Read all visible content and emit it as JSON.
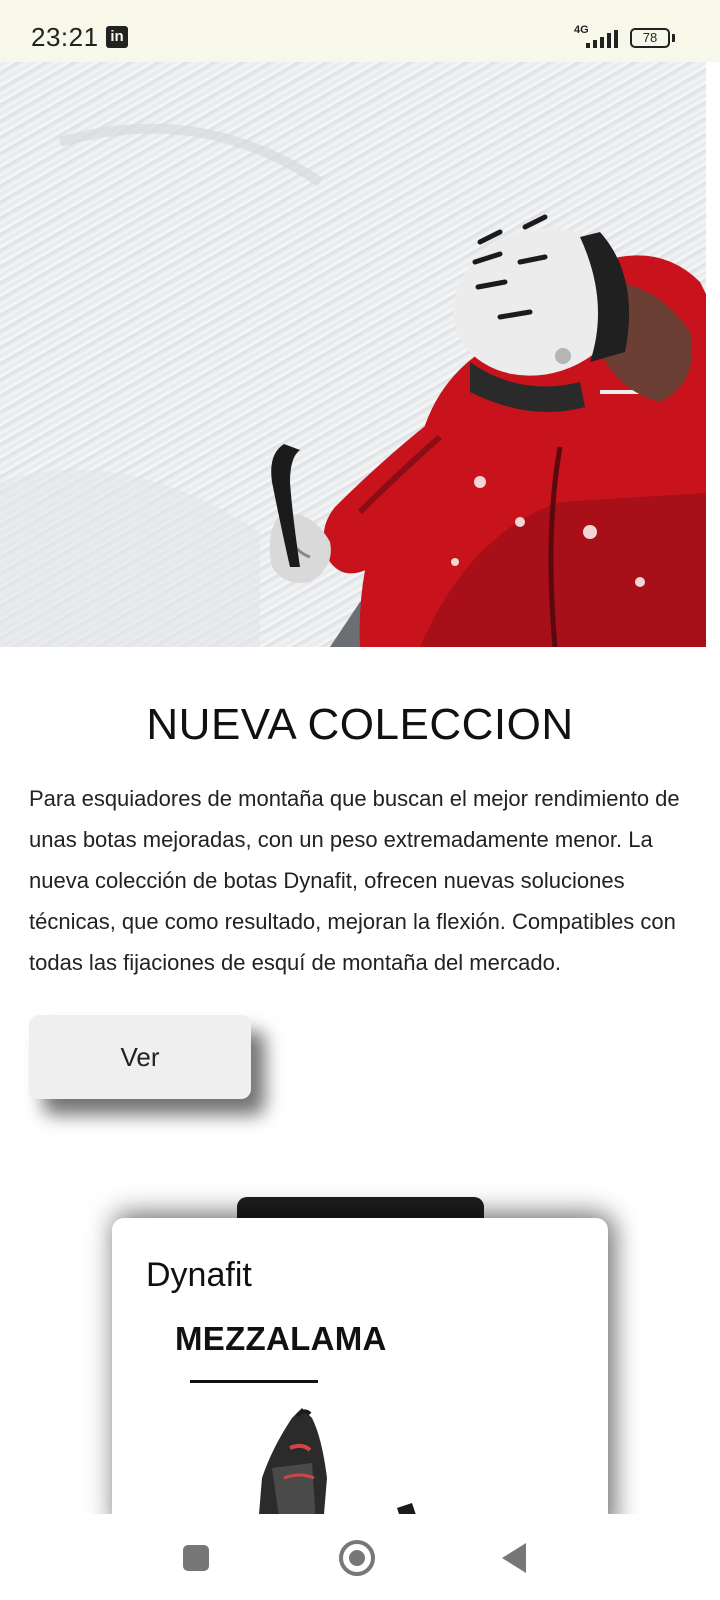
{
  "status_bar": {
    "time": "23:21",
    "notification_icon": "linkedin-icon",
    "notification_glyph": "in",
    "network": "4G",
    "signal_icon": "signal-icon",
    "battery_percent": 78,
    "battery_label": "78"
  },
  "hero": {
    "image_icon": "skier-photo"
  },
  "collection": {
    "title": "NUEVA COLECCION",
    "description": "Para esquiadores de montaña que buscan el mejor rendimiento de unas botas mejoradas, con un peso extremadamente menor. La nueva colección de botas Dynafit, ofrecen nuevas soluciones técnicas, que como resultado, mejoran la flexión. Compatibles con todas las fijaciones de esquí de montaña del mercado.",
    "button_label": "Ver"
  },
  "product_card": {
    "brand": "Dynafit",
    "name": "MEZZALAMA",
    "image_icon": "ski-boot-image"
  },
  "nav_bar": {
    "recents_icon": "square-icon",
    "home_icon": "circle-icon",
    "back_icon": "triangle-back-icon"
  }
}
